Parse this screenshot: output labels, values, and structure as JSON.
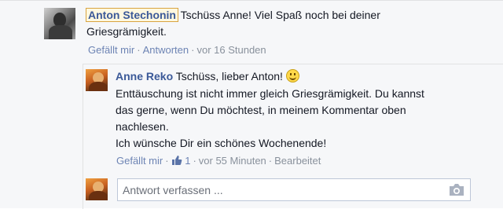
{
  "comment": {
    "author": "Anton Stechonin",
    "text_line1": "Tschüss Anne! Viel Spaß noch bei deiner",
    "text_line2": "Griesgrämigkeit.",
    "actions": {
      "like": "Gefällt mir",
      "reply": "Antworten",
      "time": "vor 16 Stunden"
    }
  },
  "reply": {
    "author": "Anne Reko",
    "first_line": "Tschüss, lieber Anton!",
    "lines": [
      "Enttäuschung ist nicht immer gleich Griesgrämigkeit. Du kannst",
      "das gerne, wenn Du möchtest, in meinem Kommentar oben",
      "nachlesen.",
      "Ich wünsche Dir ein schönes Wochenende!"
    ],
    "actions": {
      "like": "Gefällt mir",
      "like_count": "1",
      "time": "vor 55 Minuten",
      "edited": "Bearbeitet"
    }
  },
  "composer": {
    "placeholder": "Antwort verfassen ..."
  },
  "colors": {
    "link": "#3b5998",
    "action_link": "#6d84b4",
    "meta": "#89919c"
  }
}
